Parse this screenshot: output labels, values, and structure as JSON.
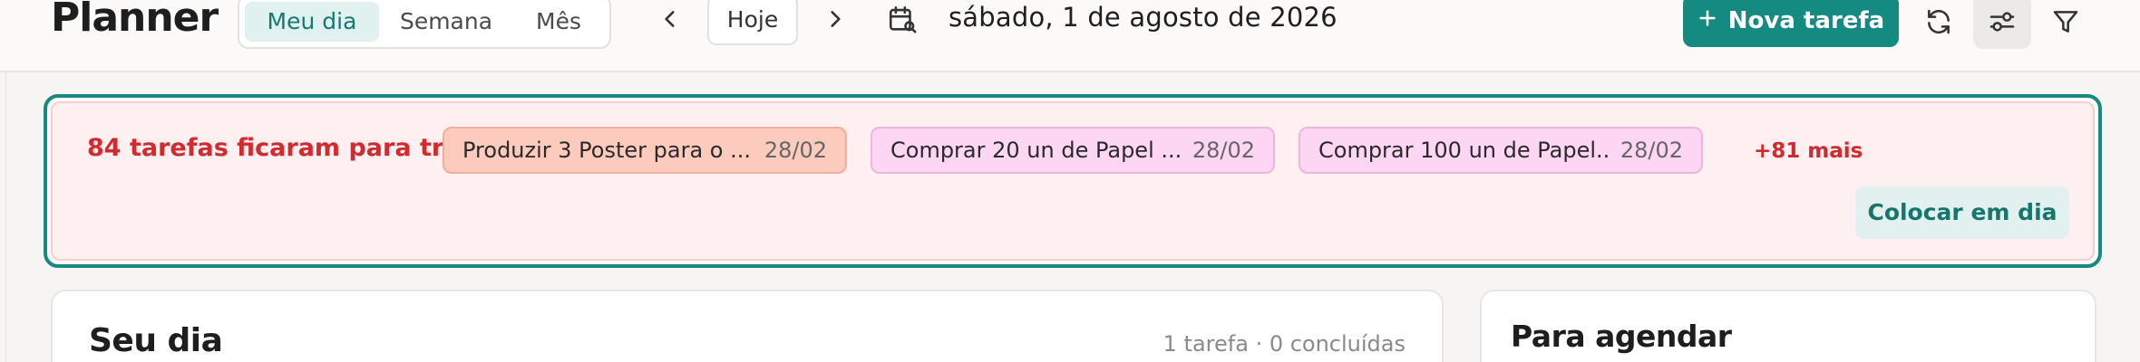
{
  "header": {
    "app_title": "Planner",
    "views": [
      {
        "label": "Meu dia",
        "active": true
      },
      {
        "label": "Semana",
        "active": false
      },
      {
        "label": "Mês",
        "active": false
      }
    ],
    "prev_icon": "chevron-left-icon",
    "today_label": "Hoje",
    "next_icon": "chevron-right-icon",
    "calendar_icon": "calendar-search-icon",
    "current_date": "sábado, 1 de agosto de 2026",
    "new_task_label": "Nova tarefa",
    "new_task_icon": "plus-icon",
    "refresh_icon": "refresh-icon",
    "settings_icon": "sliders-icon",
    "filter_icon": "filter-icon"
  },
  "overdue": {
    "title": "84 tarefas ficaram para trás",
    "chips": [
      {
        "title": "Produzir 3 Poster para o ...",
        "date": "28/02",
        "color": "#fdcbbd"
      },
      {
        "title": "Comprar 20 un de Papel ...",
        "date": "28/02",
        "color": "#fcd6f2"
      },
      {
        "title": "Comprar 100 un de Papel...",
        "date": "28/02",
        "color": "#fcd6f2"
      }
    ],
    "more_label": "+81 mais",
    "catch_up_label": "Colocar em dia"
  },
  "my_day": {
    "title": "Seu dia",
    "summary": "1 tarefa · 0 concluídas"
  },
  "to_schedule": {
    "title": "Para agendar"
  },
  "colors": {
    "accent": "#158a80",
    "danger": "#d32a2f",
    "overdue_bg": "#feeff0"
  }
}
